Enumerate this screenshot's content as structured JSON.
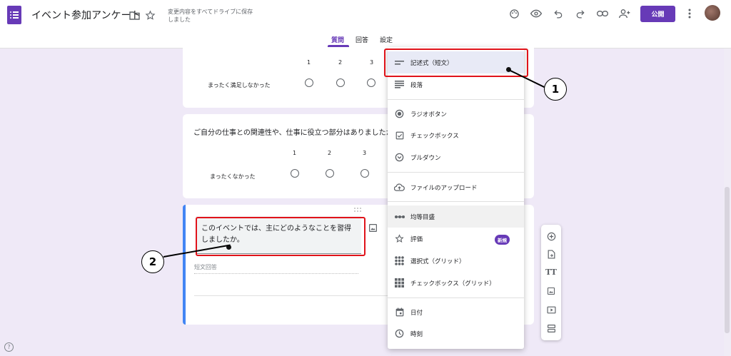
{
  "header": {
    "doc_title": "イベント参加アンケート",
    "save_status": "変更内容をすべてドライブに保存しました",
    "publish_label": "公開",
    "icons": [
      "folder-icon",
      "star-icon",
      "palette-icon",
      "preview-eye-icon",
      "undo-icon",
      "redo-icon",
      "link-icon",
      "add-person-icon",
      "more-vert-icon"
    ]
  },
  "tabs": [
    {
      "label": "質問",
      "active": true
    },
    {
      "label": "回答",
      "active": false
    },
    {
      "label": "設定",
      "active": false
    }
  ],
  "card1": {
    "scale_numbers": [
      "1",
      "2",
      "3"
    ],
    "low_label": "まったく満足しなかった"
  },
  "card2": {
    "title": "ご自分の仕事との関連性や、仕事に役立つ部分はありましたか",
    "scale_numbers": [
      "1",
      "2",
      "3"
    ],
    "low_label": "まったくなかった"
  },
  "card3": {
    "title": "このイベントでは、主にどのようなことを習得しましたか。",
    "answer_hint": "短文回答"
  },
  "menu": {
    "items": [
      {
        "label": "記述式（短文）",
        "icon": "short-text-icon",
        "state": "selected"
      },
      {
        "label": "段落",
        "icon": "paragraph-icon"
      },
      {
        "label": "ラジオボタン",
        "icon": "radio-button-icon"
      },
      {
        "label": "チェックボックス",
        "icon": "checkbox-icon"
      },
      {
        "label": "プルダウン",
        "icon": "dropdown-icon"
      },
      {
        "label": "ファイルのアップロード",
        "icon": "cloud-upload-icon"
      },
      {
        "label": "均等目盛",
        "icon": "linear-scale-icon",
        "state": "hover"
      },
      {
        "label": "評価",
        "icon": "star-rating-icon",
        "badge": "新規"
      },
      {
        "label": "選択式（グリッド）",
        "icon": "grid-dots-icon"
      },
      {
        "label": "チェックボックス（グリッド）",
        "icon": "grid-squares-icon"
      },
      {
        "label": "日付",
        "icon": "calendar-icon"
      },
      {
        "label": "時刻",
        "icon": "clock-icon"
      }
    ]
  },
  "side_toolbar": {
    "tools": [
      "add-question-icon",
      "import-questions-icon",
      "add-title-icon",
      "add-image-icon",
      "add-video-icon",
      "add-section-icon"
    ],
    "title_glyph": "TT"
  },
  "annotations": {
    "callout_1": "1",
    "callout_2": "2",
    "highlight_color": "#e0131a"
  },
  "colors": {
    "brand": "#673ab7",
    "accent_blue": "#4285f4",
    "background": "#efe9f7"
  },
  "help_glyph": "?"
}
